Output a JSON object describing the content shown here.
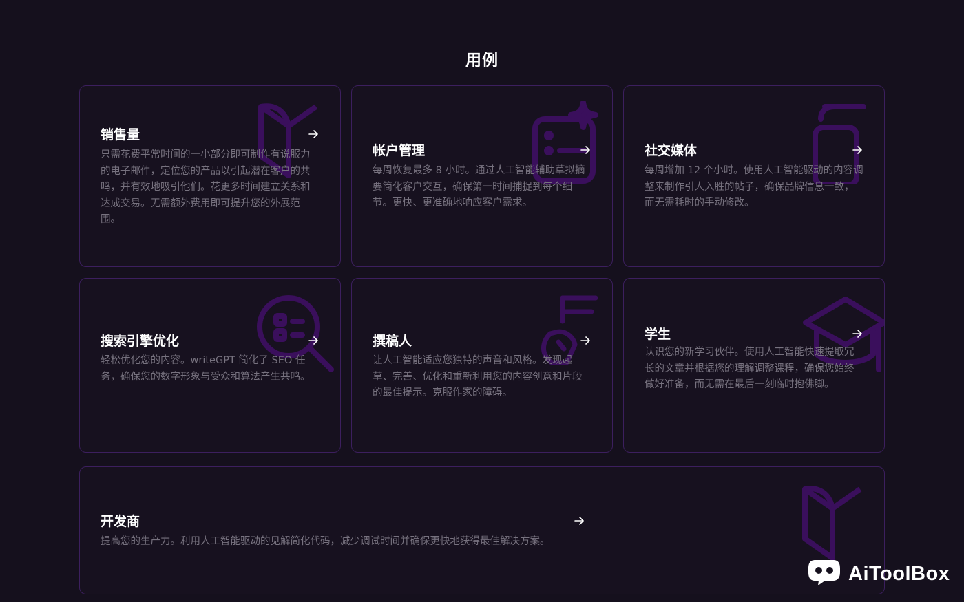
{
  "section": {
    "title": "用例"
  },
  "cards": [
    {
      "title": "销售量",
      "description": "只需花费平常时间的一小部分即可制作有说服力的电子邮件，定位您的产品以引起潜在客户的共鸣，并有效地吸引他们。花更多时间建立关系和达成交易。无需额外费用即可提升您的外展范围。",
      "icon": "book-icon"
    },
    {
      "title": "帐户管理",
      "description": "每周恢复最多 8 小时。通过人工智能辅助草拟摘要简化客户交互，确保第一时间捕捉到每个细节。更快、更准确地响应客户需求。",
      "icon": "list-sparkle-icon"
    },
    {
      "title": "社交媒体",
      "description": "每周增加 12 个小时。使用人工智能驱动的内容调整来制作引人入胜的帖子，确保品牌信息一致，而无需耗时的手动修改。",
      "icon": "phone-icon"
    },
    {
      "title": "搜索引擎优化",
      "description": "轻松优化您的内容。writeGPT 简化了 SEO 任务，确保您的数字形象与受众和算法产生共鸣。",
      "icon": "search-icon"
    },
    {
      "title": "撰稿人",
      "description": "让人工智能适应您独特的声音和风格。发现起草、完善、优化和重新利用您的内容创意和片段的最佳提示。克服作家的障碍。",
      "icon": "writer-icon"
    },
    {
      "title": "学生",
      "description": "认识您的新学习伙伴。使用人工智能快速提取冗长的文章并根据您的理解调整课程，确保您始终做好准备，而无需在最后一刻临时抱佛脚。",
      "icon": "graduation-cap-icon"
    },
    {
      "title": "开发商",
      "description": "提高您的生产力。利用人工智能驱动的见解简化代码，减少调试时间并确保更快地获得最佳解决方案。",
      "icon": "book-icon"
    }
  ],
  "watermark": {
    "text": "AiToolBox",
    "icon": "chat-bubble-icon"
  },
  "colors": {
    "background": "#15101d",
    "card_border": "#3c1f5e",
    "icon_purple": "#3a0f5c",
    "text_muted": "#77727f"
  }
}
